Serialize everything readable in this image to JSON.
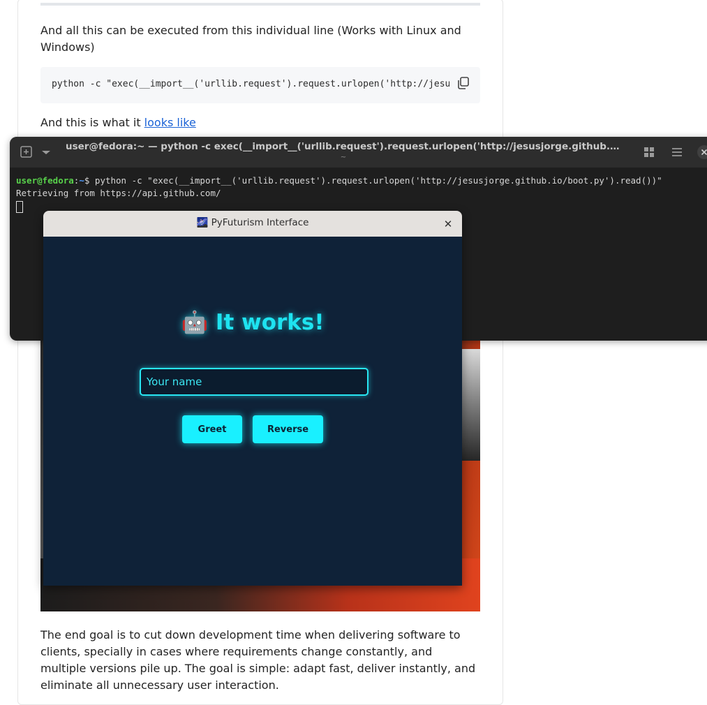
{
  "article": {
    "intro_text": "And all this can be executed from this individual line (Works with Linux and Windows)",
    "code_line": "python -c \"exec(__import__('urllib.request').request.urlopen('http://jesusjorge.github.io/boot.py').read())\"",
    "looks_prefix": "And this is what it ",
    "looks_link": "looks like",
    "closing_text": "The end goal is to cut down development time when delivering software to clients, specially in cases where requirements change constantly, and multiple versions pile up. The goal is simple: adapt fast, deliver instantly, and eliminate all unnecessary user interaction."
  },
  "terminal": {
    "title": "user@fedora:~ — python -c exec(__import__('urllib.request').request.urlopen('http://jesusjorge.github.io/boot.py').r…",
    "subtitle": "~",
    "prompt_user": "user@fedora",
    "prompt_sep": ":",
    "prompt_path": "~",
    "prompt_symbol": "$ ",
    "command": "python -c \"exec(__import__('urllib.request').request.urlopen('http://jesusjorge.github.io/boot.py').read())\"",
    "output_line": "Retrieving from https://api.github.com/",
    "icons": [
      "new-tab-icon",
      "dropdown-icon",
      "grid-icon",
      "menu-icon",
      "close-icon"
    ]
  },
  "dialog": {
    "title": "🌌 PyFuturism Interface",
    "close_glyph": "✕",
    "heading": "🤖 It works!",
    "input_placeholder": "Your name",
    "greet_label": "Greet",
    "reverse_label": "Reverse",
    "accent_color": "#19f0ff",
    "background_color": "#0f2238"
  }
}
